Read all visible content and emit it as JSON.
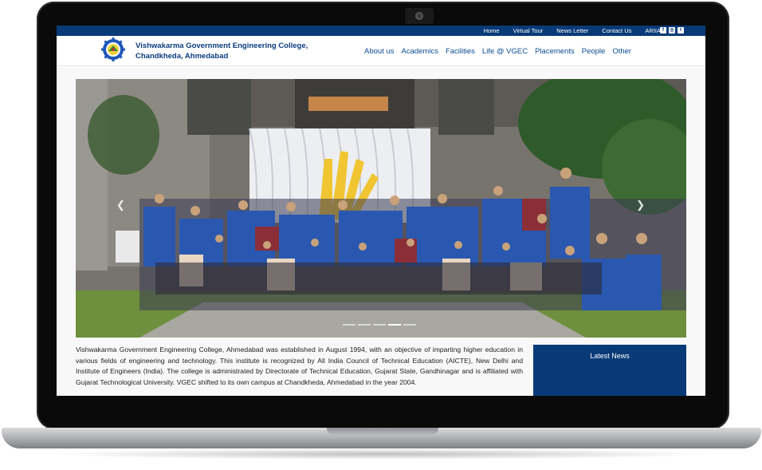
{
  "topnav": {
    "items": [
      "Home",
      "Virtual Tour",
      "News Letter",
      "Contact Us",
      "ARIIA"
    ],
    "social_icons": [
      "facebook-icon",
      "instagram-icon",
      "twitter-icon"
    ]
  },
  "header": {
    "college_line1": "Vishwakarma Government Engineering College,",
    "college_line2": "Chandkheda, Ahmedabad",
    "nav": [
      "About us",
      "Academics",
      "Facilities",
      "Life @ VGEC",
      "Placements",
      "People",
      "Other"
    ]
  },
  "slider": {
    "prev_icon": "chevron-left-icon",
    "next_icon": "chevron-right-icon",
    "slide_count": 5,
    "active_slide": 4
  },
  "about": {
    "text": "Vishwakarma Government Engineering College, Ahmedabad was established in August 1994, with an objective of imparting higher education in various fields of engineering and technology. This institute is recognized by All India Council of Technical Education (AICTE), New Delhi and Institute of Engineers (India). The college is administrated by Directorate of Technical Education, Gujarat State, Gandhinagar and is affiliated with Gujarat Technological University. VGEC shifted to its own campus at Chandkheda, Ahmedabad in the year 2004."
  },
  "news": {
    "title": "Latest News"
  },
  "colors": {
    "brand_blue": "#083a78",
    "nav_blue": "#0b4d93"
  }
}
